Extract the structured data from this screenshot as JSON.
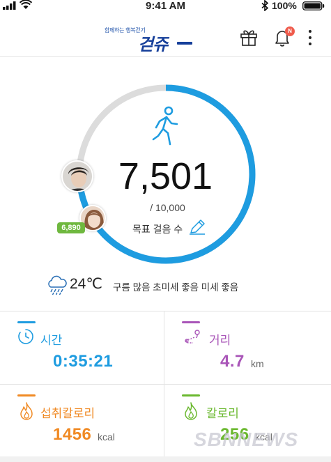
{
  "status_bar": {
    "time": "9:41 AM",
    "battery_pct": "100%",
    "icons": [
      "signal-icon",
      "wifi-icon",
      "bluetooth-icon",
      "battery-icon"
    ]
  },
  "header": {
    "logo_tagline": "함께하는 행복걷기",
    "logo_text": "걷쥬",
    "notification_badge": "N",
    "icons": [
      "gift-icon",
      "bell-icon",
      "more-icon"
    ]
  },
  "progress": {
    "steps": "7,501",
    "goal": "/ 10,000",
    "goal_label": "목표 걸음 수",
    "fraction": 0.7501,
    "friend_steps": "6,890",
    "colors": {
      "accent": "#1e9ce0",
      "track": "#dcdcdc",
      "friend_badge": "#6fb83f"
    }
  },
  "weather": {
    "temperature": "24℃",
    "description": "구름 많음  초미세 좋음  미세 좋음"
  },
  "stats": [
    {
      "label": "시간",
      "value": "0:35:21",
      "unit": "",
      "color": "#1e9ce0",
      "icon": "clock-icon"
    },
    {
      "label": "거리",
      "value": "4.7",
      "unit": "km",
      "color": "#a955b8",
      "icon": "route-icon"
    },
    {
      "label": "섭취칼로리",
      "value": "1456",
      "unit": "kcal",
      "color": "#f08a24",
      "icon": "flame-icon"
    },
    {
      "label": "칼로리",
      "value": "256",
      "unit": "kcal",
      "color": "#6ab82e",
      "icon": "flame-icon"
    }
  ],
  "watermark": "SBNNEWS"
}
